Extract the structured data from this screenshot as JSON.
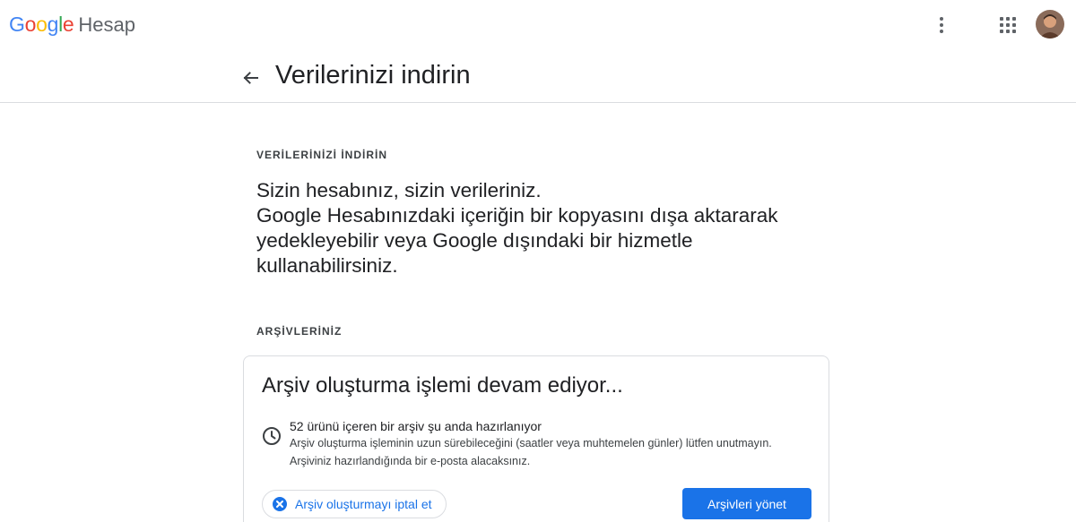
{
  "app": {
    "logo_letters": [
      {
        "ch": "G",
        "color": "#4285F4"
      },
      {
        "ch": "o",
        "color": "#EA4335"
      },
      {
        "ch": "o",
        "color": "#FBBC05"
      },
      {
        "ch": "g",
        "color": "#4285F4"
      },
      {
        "ch": "l",
        "color": "#34A853"
      },
      {
        "ch": "e",
        "color": "#EA4335"
      }
    ],
    "product_name": "Hesap",
    "icons": {
      "more": "more-vert-icon",
      "apps": "apps-grid-icon",
      "avatar": "user-avatar"
    }
  },
  "header": {
    "title": "Verilerinizi indirin",
    "back_icon": "arrow-back-icon"
  },
  "intro": {
    "label": "VERİLERİNİZİ İNDİRİN",
    "lines": [
      "Sizin hesabınız, sizin verileriniz.",
      "Google Hesabınızdaki içeriğin bir kopyasını dışa aktararak",
      "yedekleyebilir veya Google dışındaki bir hizmetle",
      "kullanabilirsiniz."
    ]
  },
  "archives": {
    "label": "ARŞİVLERİNİZ",
    "card": {
      "title": "Arşiv oluşturma işlemi devam ediyor...",
      "status_icon": "clock-icon",
      "status_main": "52 ürünü içeren bir arşiv şu anda hazırlanıyor",
      "status_sub_1": "Arşiv oluşturma işleminin uzun sürebileceğini (saatler veya muhtemelen günler) lütfen unutmayın.",
      "status_sub_2": "Arşiviniz hazırlandığında bir e-posta alacaksınız.",
      "cancel_label": "Arşiv oluşturmayı iptal et",
      "cancel_icon": "cancel-circle-icon",
      "manage_label": "Arşivleri yönet"
    }
  },
  "colors": {
    "accent": "#1a73e8",
    "divider": "#dadce0"
  }
}
